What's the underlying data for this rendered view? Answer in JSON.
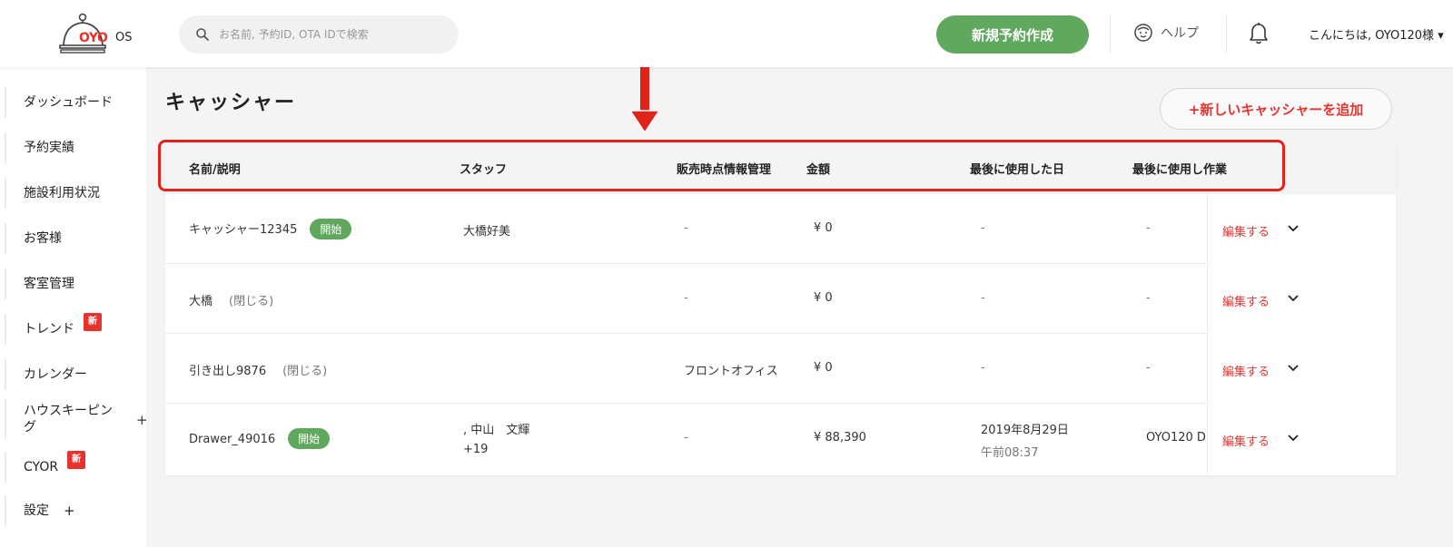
{
  "header": {
    "logo_text": "OYO",
    "logo_suffix": "OS",
    "search_placeholder": "お名前, 予約ID, OTA IDで検索",
    "new_booking_label": "新規予約作成",
    "help_label": "ヘルプ",
    "greeting": "こんにちは, OYO120様 ▾"
  },
  "sidebar": {
    "items": [
      {
        "label": "ダッシュボード"
      },
      {
        "label": "予約実績"
      },
      {
        "label": "施設利用状況"
      },
      {
        "label": "お客様"
      },
      {
        "label": "客室管理"
      },
      {
        "label": "トレンド",
        "badge": "新"
      },
      {
        "label": "カレンダー"
      },
      {
        "label": "ハウスキーピング",
        "expand": "+"
      },
      {
        "label": "CYOR",
        "badge": "新"
      },
      {
        "label": "設定",
        "expand": "+"
      }
    ]
  },
  "page": {
    "title": "キャッシャー",
    "add_label": "+新しいキャッシャーを追加"
  },
  "table": {
    "columns": [
      "名前/説明",
      "スタッフ",
      "販売時点情報管理",
      "金額",
      "最後に使用した日",
      "最後に使用し作業"
    ],
    "edit_label": "編集する",
    "rows": [
      {
        "name": "キャッシャー12345",
        "status": "開始",
        "staff": "大橋好美",
        "staff_extra": "",
        "pos": "-",
        "amount": "¥ 0",
        "last_date": "-",
        "last_time": "",
        "last_op": "-"
      },
      {
        "name": "大橋",
        "status_closed": "(閉じる)",
        "staff": "",
        "staff_extra": "",
        "pos": "-",
        "amount": "¥ 0",
        "last_date": "-",
        "last_time": "",
        "last_op": "-"
      },
      {
        "name": "引き出し9876",
        "status_closed": "(閉じる)",
        "staff": "",
        "staff_extra": "",
        "pos": "フロントオフィス",
        "amount": "¥ 0",
        "last_date": "-",
        "last_time": "",
        "last_op": "-"
      },
      {
        "name": "Drawer_49016",
        "status": "開始",
        "staff": ", 中山　文輝",
        "staff_extra": "+19",
        "pos": "-",
        "amount": "¥ 88,390",
        "last_date": "2019年8月29日",
        "last_time": "午前08:37",
        "last_op": "OYO120 D"
      }
    ]
  },
  "colors": {
    "accent_red": "#e8322c",
    "primary_green": "#5fa85d",
    "annotation_red": "#e2231a"
  }
}
